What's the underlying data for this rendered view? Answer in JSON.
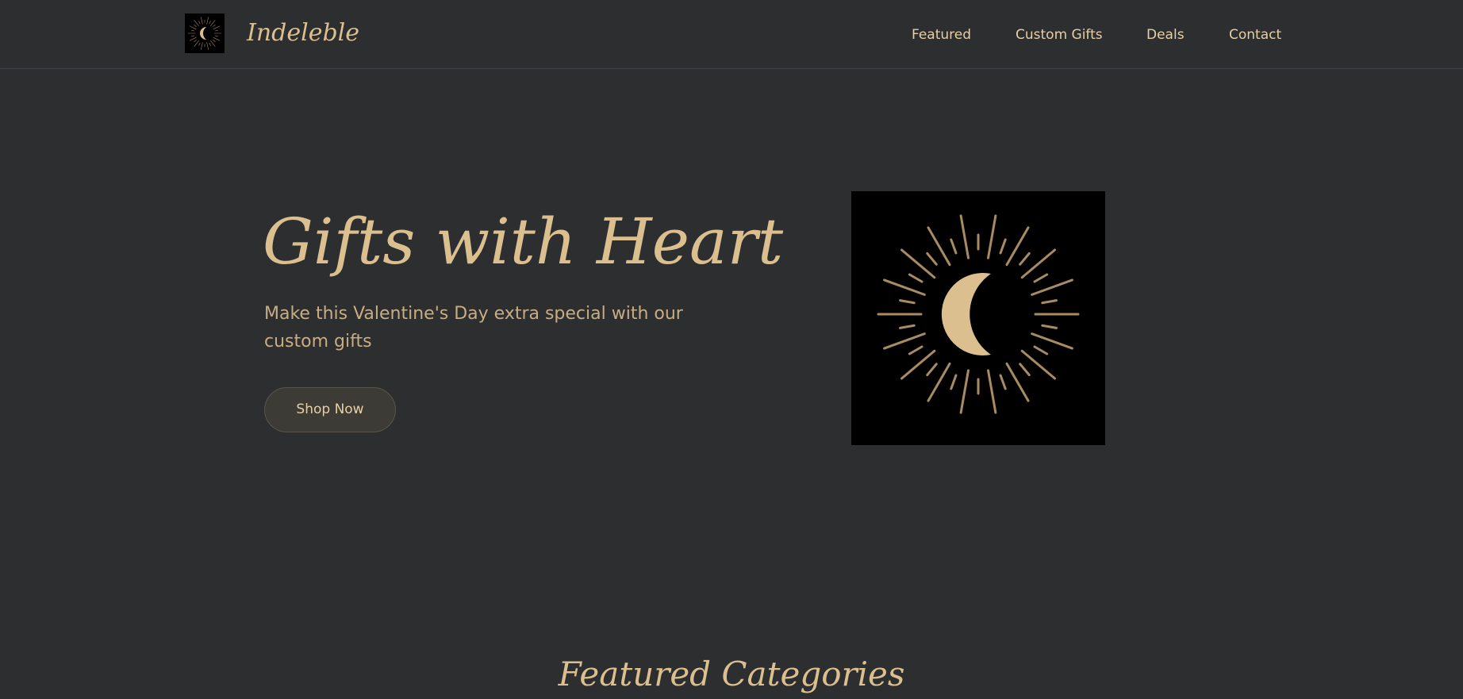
{
  "header": {
    "brand": "Indeleble",
    "logo_icon": "moon-sunburst-icon",
    "nav": [
      {
        "label": "Featured"
      },
      {
        "label": "Custom Gifts"
      },
      {
        "label": "Deals"
      },
      {
        "label": "Contact"
      }
    ]
  },
  "hero": {
    "title": "Gifts with Heart",
    "subtitle": "Make this Valentine's Day extra special with our custom gifts",
    "cta_label": "Shop Now",
    "image_icon": "moon-sunburst-icon"
  },
  "featured": {
    "title": "Featured Categories"
  },
  "colors": {
    "background": "#2d2e30",
    "accent_gold": "#dcbf8f",
    "text_light": "#e5cfa6",
    "button_bg": "#3d3b36"
  }
}
